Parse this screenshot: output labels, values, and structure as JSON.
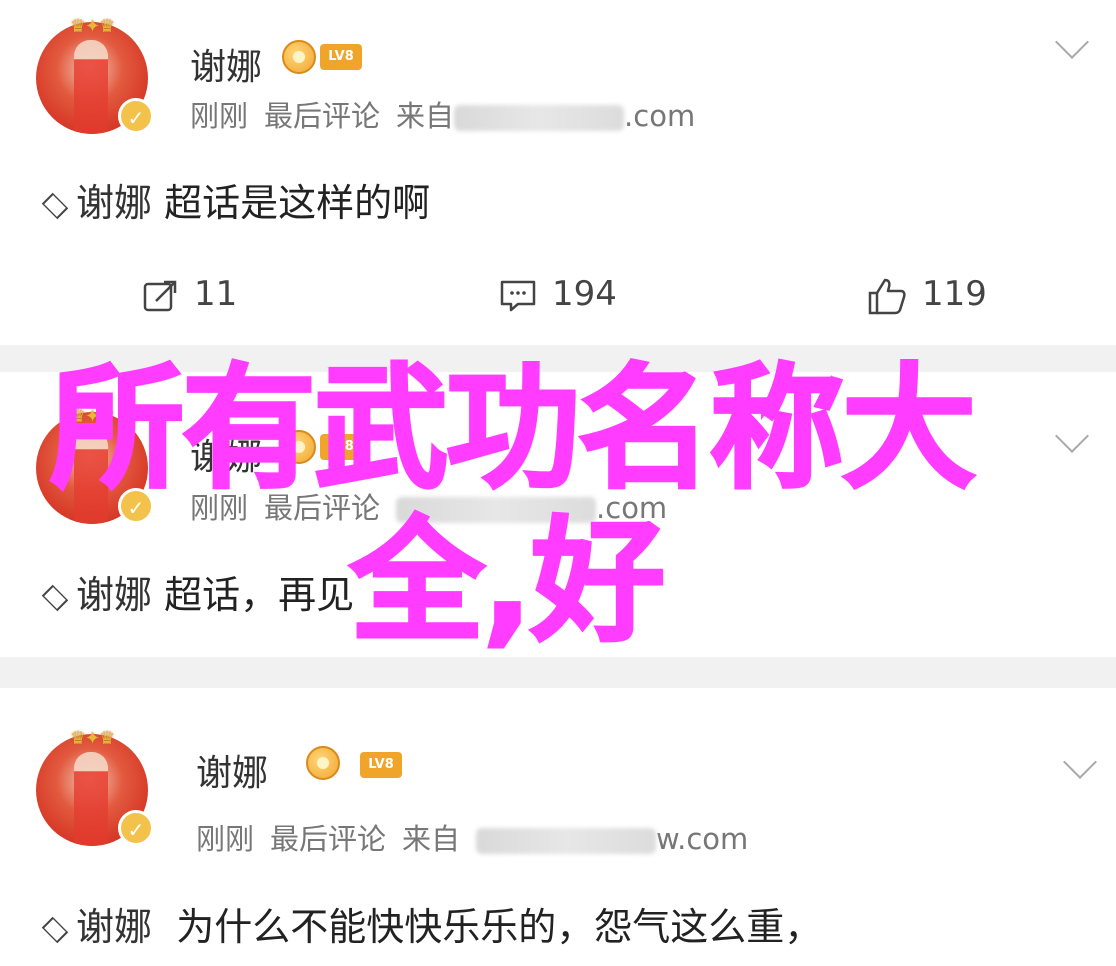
{
  "posts": [
    {
      "username": "谢娜",
      "level": "LV8",
      "time": "刚刚",
      "action": "最后评论",
      "source_prefix": "来自",
      "source_suffix": ".com",
      "tag": "谢娜",
      "text": "超话是这样的啊",
      "reposts": "11",
      "comments": "194",
      "likes": "119"
    },
    {
      "username": "谢娜",
      "level": "LV8",
      "time": "刚刚",
      "action": "最后评论",
      "source_suffix": ".com",
      "tag": "谢娜",
      "text": "超话，再见"
    },
    {
      "username": "谢娜",
      "level": "LV8",
      "time": "刚刚",
      "action": "最后评论",
      "source_prefix": "来自",
      "source_suffix": "w.com",
      "tag": "谢娜",
      "text": "为什么不能快快乐乐的，怨气这么重，"
    }
  ],
  "overlay": {
    "line1": "所有武功名称大",
    "line2": "全,好",
    "color": "#ff3cff"
  },
  "icons": [
    "repost-icon",
    "comment-icon",
    "like-icon",
    "chevron-down-icon",
    "verified-icon",
    "medal-icon",
    "supertopic-icon"
  ]
}
